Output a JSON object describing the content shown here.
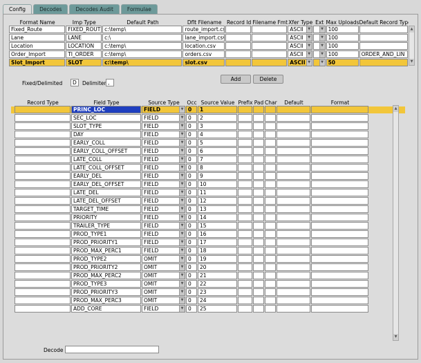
{
  "tabs": [
    {
      "label": "Config"
    },
    {
      "label": "Decodes"
    },
    {
      "label": "Decodes Audit"
    },
    {
      "label": "Formulae"
    }
  ],
  "format_grid": {
    "headers": [
      "Format Name",
      "Imp Type",
      "Default Path",
      "Dflt Filename",
      "Record Id",
      "Filename Fmt",
      "Xfer Type",
      "Ext",
      "Max Uploads",
      "Default Record Type"
    ],
    "rows": [
      {
        "name": "Fixed_Route",
        "imp_type": "FIXED_ROUT",
        "path": "c:\\temp\\",
        "filename": "route_import.csv",
        "record_id": "",
        "filename_fmt": "",
        "xfer": "ASCII",
        "ext": "",
        "max_uploads": "100",
        "default_record_type": ""
      },
      {
        "name": "Lane",
        "imp_type": "LANE",
        "path": "c:\\",
        "filename": "lane_import.csv",
        "record_id": "",
        "filename_fmt": "",
        "xfer": "ASCII",
        "ext": "",
        "max_uploads": "100",
        "default_record_type": ""
      },
      {
        "name": "Location",
        "imp_type": "LOCATION",
        "path": "c:\\temp\\",
        "filename": "location.csv",
        "record_id": "",
        "filename_fmt": "",
        "xfer": "ASCII",
        "ext": "",
        "max_uploads": "100",
        "default_record_type": ""
      },
      {
        "name": "Order_Import",
        "imp_type": "TI_ORDER",
        "path": "c:\\temp\\",
        "filename": "orders.csv",
        "record_id": "",
        "filename_fmt": "",
        "xfer": "ASCII",
        "ext": "",
        "max_uploads": "100",
        "default_record_type": "ORDER_AND_LIN"
      },
      {
        "name": "Slot_Import",
        "imp_type": "SLOT",
        "path": "c:\\temp\\",
        "filename": "slot.csv",
        "record_id": "",
        "filename_fmt": "",
        "xfer": "ASCII",
        "ext": "",
        "max_uploads": "50",
        "default_record_type": ""
      }
    ]
  },
  "buttons": {
    "add": "Add",
    "delete": "Delete"
  },
  "options": {
    "fixed_delimited_label": "Fixed/Delimited",
    "fixed_delimited_value": "D",
    "delimiter_label": "Delimiter",
    "delimiter_value": ","
  },
  "field_grid": {
    "headers": [
      "Record Type",
      "Field Type",
      "Source Type",
      "Occ",
      "Source Value",
      "Prefix",
      "Pad",
      "Char",
      "Default",
      "Format"
    ],
    "rows": [
      {
        "record_type": "",
        "field_type": "PRINC_LOC",
        "source_type": "FIELD",
        "occ": "0",
        "source_value": "1"
      },
      {
        "record_type": "",
        "field_type": "SEC_LOC",
        "source_type": "FIELD",
        "occ": "0",
        "source_value": "2"
      },
      {
        "record_type": "",
        "field_type": "SLOT_TYPE",
        "source_type": "FIELD",
        "occ": "0",
        "source_value": "3"
      },
      {
        "record_type": "",
        "field_type": "DAY",
        "source_type": "FIELD",
        "occ": "0",
        "source_value": "4"
      },
      {
        "record_type": "",
        "field_type": "EARLY_COLL",
        "source_type": "FIELD",
        "occ": "0",
        "source_value": "5"
      },
      {
        "record_type": "",
        "field_type": "EARLY_COLL_OFFSET",
        "source_type": "FIELD",
        "occ": "0",
        "source_value": "6"
      },
      {
        "record_type": "",
        "field_type": "LATE_COLL",
        "source_type": "FIELD",
        "occ": "0",
        "source_value": "7"
      },
      {
        "record_type": "",
        "field_type": "LATE_COLL_OFFSET",
        "source_type": "FIELD",
        "occ": "0",
        "source_value": "8"
      },
      {
        "record_type": "",
        "field_type": "EARLY_DEL",
        "source_type": "FIELD",
        "occ": "0",
        "source_value": "9"
      },
      {
        "record_type": "",
        "field_type": "EARLY_DEL_OFFSET",
        "source_type": "FIELD",
        "occ": "0",
        "source_value": "10"
      },
      {
        "record_type": "",
        "field_type": "LATE_DEL",
        "source_type": "FIELD",
        "occ": "0",
        "source_value": "11"
      },
      {
        "record_type": "",
        "field_type": "LATE_DEL_OFFSET",
        "source_type": "FIELD",
        "occ": "0",
        "source_value": "12"
      },
      {
        "record_type": "",
        "field_type": "TARGET_TIME",
        "source_type": "FIELD",
        "occ": "0",
        "source_value": "13"
      },
      {
        "record_type": "",
        "field_type": "PRIORITY",
        "source_type": "FIELD",
        "occ": "0",
        "source_value": "14"
      },
      {
        "record_type": "",
        "field_type": "TRAILER_TYPE",
        "source_type": "FIELD",
        "occ": "0",
        "source_value": "15"
      },
      {
        "record_type": "",
        "field_type": "PROD_TYPE1",
        "source_type": "FIELD",
        "occ": "0",
        "source_value": "16"
      },
      {
        "record_type": "",
        "field_type": "PROD_PRIORITY1",
        "source_type": "FIELD",
        "occ": "0",
        "source_value": "17"
      },
      {
        "record_type": "",
        "field_type": "PROD_MAX_PERC1",
        "source_type": "FIELD",
        "occ": "0",
        "source_value": "18"
      },
      {
        "record_type": "",
        "field_type": "PROD_TYPE2",
        "source_type": "OMIT",
        "occ": "0",
        "source_value": "19"
      },
      {
        "record_type": "",
        "field_type": "PROD_PRIORITY2",
        "source_type": "OMIT",
        "occ": "0",
        "source_value": "20"
      },
      {
        "record_type": "",
        "field_type": "PROD_MAX_PERC2",
        "source_type": "OMIT",
        "occ": "0",
        "source_value": "21"
      },
      {
        "record_type": "",
        "field_type": "PROD_TYPE3",
        "source_type": "OMIT",
        "occ": "0",
        "source_value": "22"
      },
      {
        "record_type": "",
        "field_type": "PROD_PRIORITY3",
        "source_type": "OMIT",
        "occ": "0",
        "source_value": "23"
      },
      {
        "record_type": "",
        "field_type": "PROD_MAX_PERC3",
        "source_type": "OMIT",
        "occ": "0",
        "source_value": "24"
      },
      {
        "record_type": "",
        "field_type": "ADD_CORE",
        "source_type": "FIELD",
        "occ": "0",
        "source_value": "25"
      }
    ]
  },
  "decode": {
    "label": "Decode",
    "value": ""
  },
  "colors": {
    "tab": "#6d9a9a",
    "selection": "#f2c63a",
    "highlight": "#1f3fbf",
    "panel": "#dcdcdc"
  }
}
